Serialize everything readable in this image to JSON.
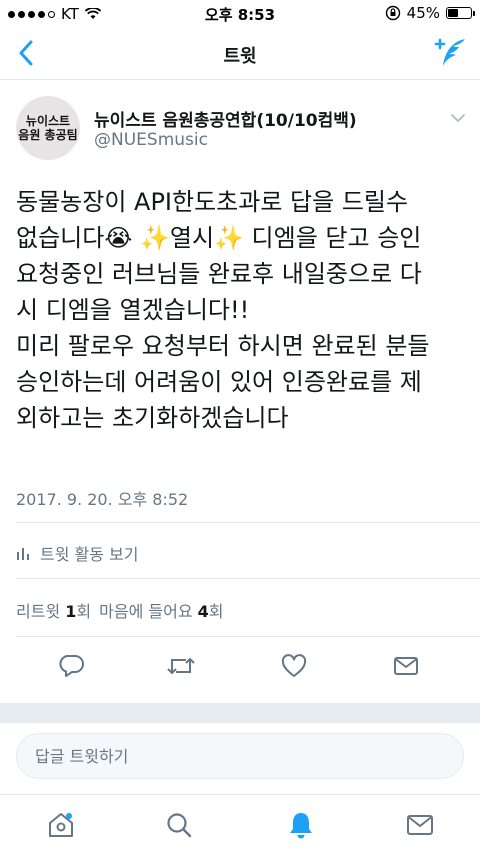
{
  "status_bar": {
    "carrier": "KT",
    "time": "오후 8:53",
    "battery_percent": "45%",
    "battery_level": 0.45,
    "signal_bars": 4
  },
  "nav": {
    "title": "트윗",
    "back_icon": "chevron-left-icon",
    "compose_icon": "compose-tweet-icon",
    "accent_color": "#1da1f2"
  },
  "tweet": {
    "author_name": "뉴이스트 음원총공연합(10/10컴백)",
    "author_handle": "@NUESmusic",
    "avatar_text": [
      "뉴이스트",
      "음원 총공팀"
    ],
    "text_lines": [
      "동물농장이 API한도초과로 답을 드릴수",
      "없습니다😭 ✨열시✨ 디엠을 닫고 승인",
      "요청중인 러브님들 완료후 내일중으로 다",
      "시 디엠을 열겠습니다!!",
      "미리 팔로우 요청부터 하시면 완료된 분들",
      "승인하는데 어려움이 있어 인증완료를 제",
      "외하고는 초기화하겠습니다"
    ],
    "timestamp": "2017. 9. 20. 오후 8:52",
    "activity_label": "트윗 활동 보기",
    "retweet_label": "리트윗",
    "retweet_count": "1",
    "retweet_suffix": "회",
    "like_label": "마음에 들어요",
    "like_count": "4",
    "like_suffix": "회"
  },
  "reply": {
    "placeholder": "답글 트윗하기"
  },
  "actions": [
    "reply-icon",
    "retweet-icon",
    "like-icon",
    "dm-icon"
  ],
  "tabs": [
    "home-icon",
    "search-icon",
    "notifications-icon",
    "messages-icon"
  ]
}
